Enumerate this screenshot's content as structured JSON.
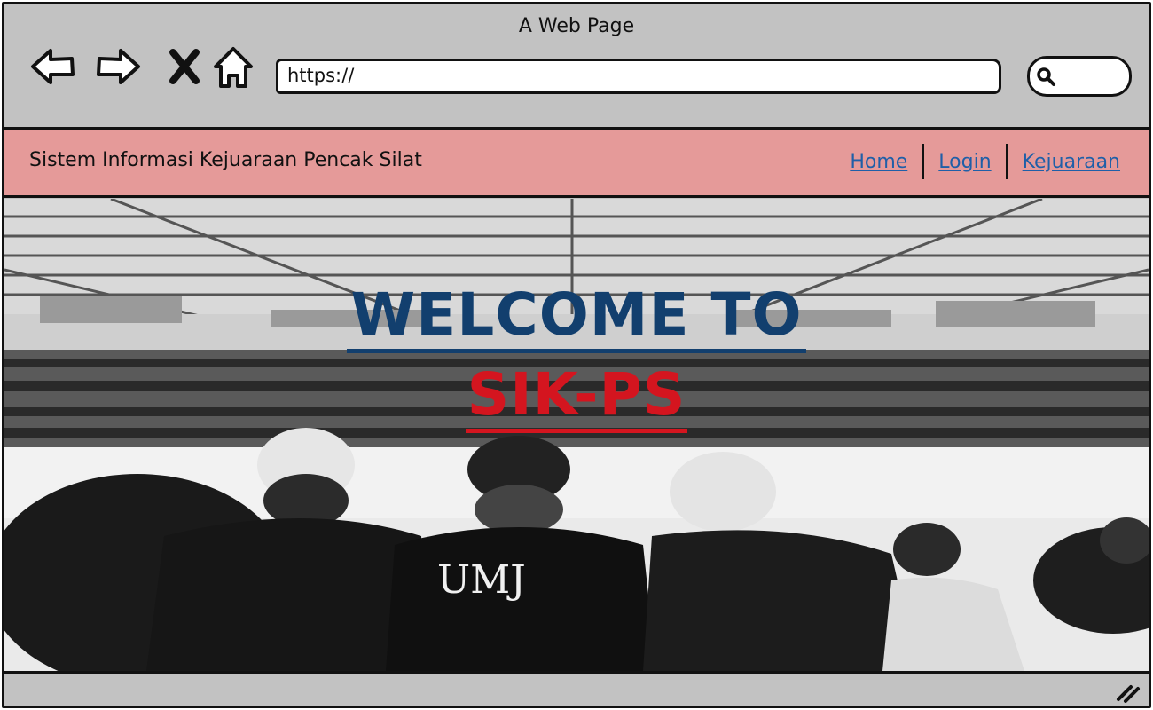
{
  "window": {
    "title": "A Web Page"
  },
  "toolbar": {
    "back_icon": "back-arrow-icon",
    "forward_icon": "forward-arrow-icon",
    "stop_icon": "close-x-icon",
    "home_icon": "home-icon",
    "url": "https://",
    "search_icon": "search-icon"
  },
  "navbar": {
    "brand": "Sistem Informasi Kejuaraan Pencak Silat",
    "links": [
      {
        "label": "Home"
      },
      {
        "label": "Login"
      },
      {
        "label": "Kejuaraan"
      }
    ]
  },
  "hero": {
    "line1": "WELCOME TO",
    "line2": "SIK-PS",
    "jersey_text": "UMJ",
    "colors": {
      "line1": "#123f6e",
      "line2": "#d4151f"
    }
  },
  "colors": {
    "chrome": "#c2c2c2",
    "navbar": "#e59a99",
    "link": "#1f5fa8"
  }
}
